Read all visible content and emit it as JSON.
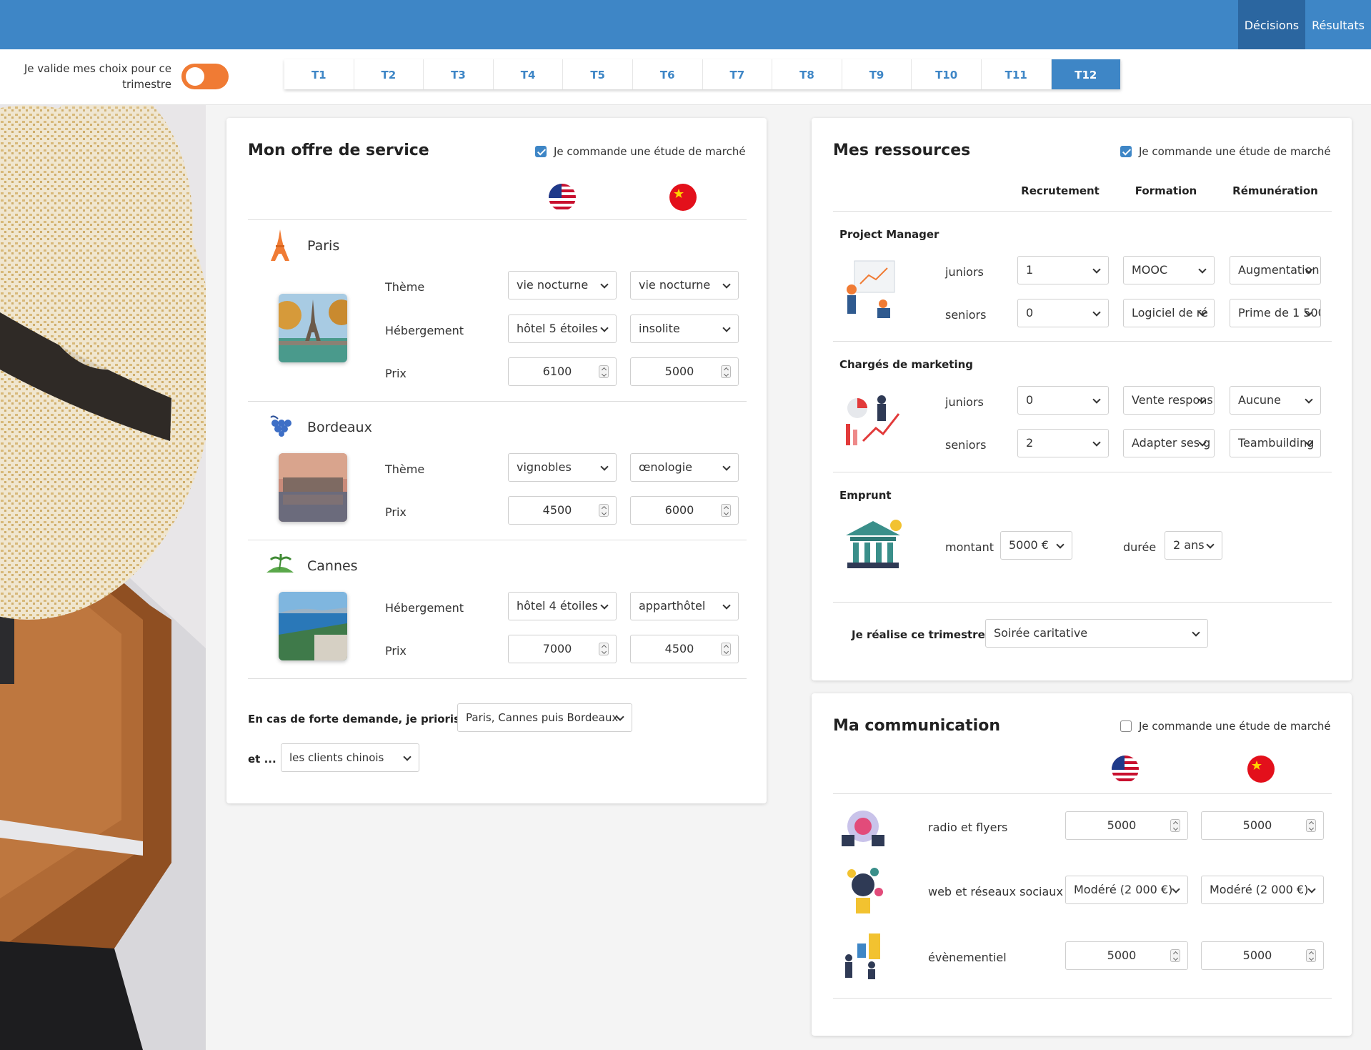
{
  "nav": {
    "decisions": "Décisions",
    "results": "Résultats"
  },
  "validate": {
    "line1": "Je valide mes choix pour ce",
    "line2": "trimestre"
  },
  "tabs": [
    "T1",
    "T2",
    "T3",
    "T4",
    "T5",
    "T6",
    "T7",
    "T8",
    "T9",
    "T10",
    "T11",
    "T12"
  ],
  "active_tab": "T12",
  "colors": {
    "primary": "#3e86c6",
    "primary_dark": "#2b66a0",
    "toggle": "#f07b34"
  },
  "offre": {
    "title": "Mon offre de service",
    "study_label": "Je commande une étude de marché",
    "study_checked": true,
    "flags": [
      "flag-usa-icon",
      "flag-china-icon"
    ],
    "paris": {
      "city": "Paris",
      "theme_label": "Thème",
      "theme_us": "vie nocturne",
      "theme_cn": "vie nocturne",
      "heb_label": "Hébergement",
      "heb_us": "hôtel 5 étoiles",
      "heb_cn": "insolite",
      "prix_label": "Prix",
      "prix_us": "6100",
      "prix_cn": "5000"
    },
    "bordeaux": {
      "city": "Bordeaux",
      "theme_label": "Thème",
      "theme_us": "vignobles",
      "theme_cn": "œnologie",
      "prix_label": "Prix",
      "prix_us": "4500",
      "prix_cn": "6000"
    },
    "cannes": {
      "city": "Cannes",
      "heb_label": "Hébergement",
      "heb_us": "hôtel 4 étoiles",
      "heb_cn": "apparthôtel",
      "prix_label": "Prix",
      "prix_us": "7000",
      "prix_cn": "4500"
    },
    "demand_label": "En cas de forte demande, je priorise...",
    "demand_value": "Paris, Cannes puis Bordeaux",
    "et_label": "et ...",
    "et_value": "les clients chinois"
  },
  "ressources": {
    "title": "Mes ressources",
    "study_label": "Je commande une étude de marché",
    "study_checked": true,
    "cols": [
      "Recrutement",
      "Formation",
      "Rémunération"
    ],
    "pm": {
      "title": "Project Manager",
      "juniors_label": "juniors",
      "seniors_label": "seniors",
      "juniors": [
        "1",
        "MOOC",
        "Augmentation"
      ],
      "seniors": [
        "0",
        "Logiciel de ré",
        "Prime de 1 500"
      ]
    },
    "mk": {
      "title": "Chargés de marketing",
      "juniors_label": "juniors",
      "seniors_label": "seniors",
      "juniors": [
        "0",
        "Vente respons",
        "Aucune"
      ],
      "seniors": [
        "2",
        "Adapter ses g",
        "Teambuilding"
      ]
    },
    "emprunt": {
      "title": "Emprunt",
      "montant_label": "montant",
      "montant": "5000 €",
      "duree_label": "durée",
      "duree": "2 ans"
    },
    "realise_label": "Je réalise ce trimestre...",
    "realise_value": "Soirée caritative"
  },
  "communication": {
    "title": "Ma communication",
    "study_label": "Je commande une étude de marché",
    "study_checked": false,
    "flags": [
      "flag-usa-icon",
      "flag-china-icon"
    ],
    "radio": {
      "label": "radio et flyers",
      "us": "5000",
      "cn": "5000"
    },
    "web": {
      "label": "web et réseaux sociaux",
      "us": "Modéré (2 000 €)",
      "cn": "Modéré (2 000 €)"
    },
    "event": {
      "label": "évènementiel",
      "us": "5000",
      "cn": "5000"
    }
  }
}
